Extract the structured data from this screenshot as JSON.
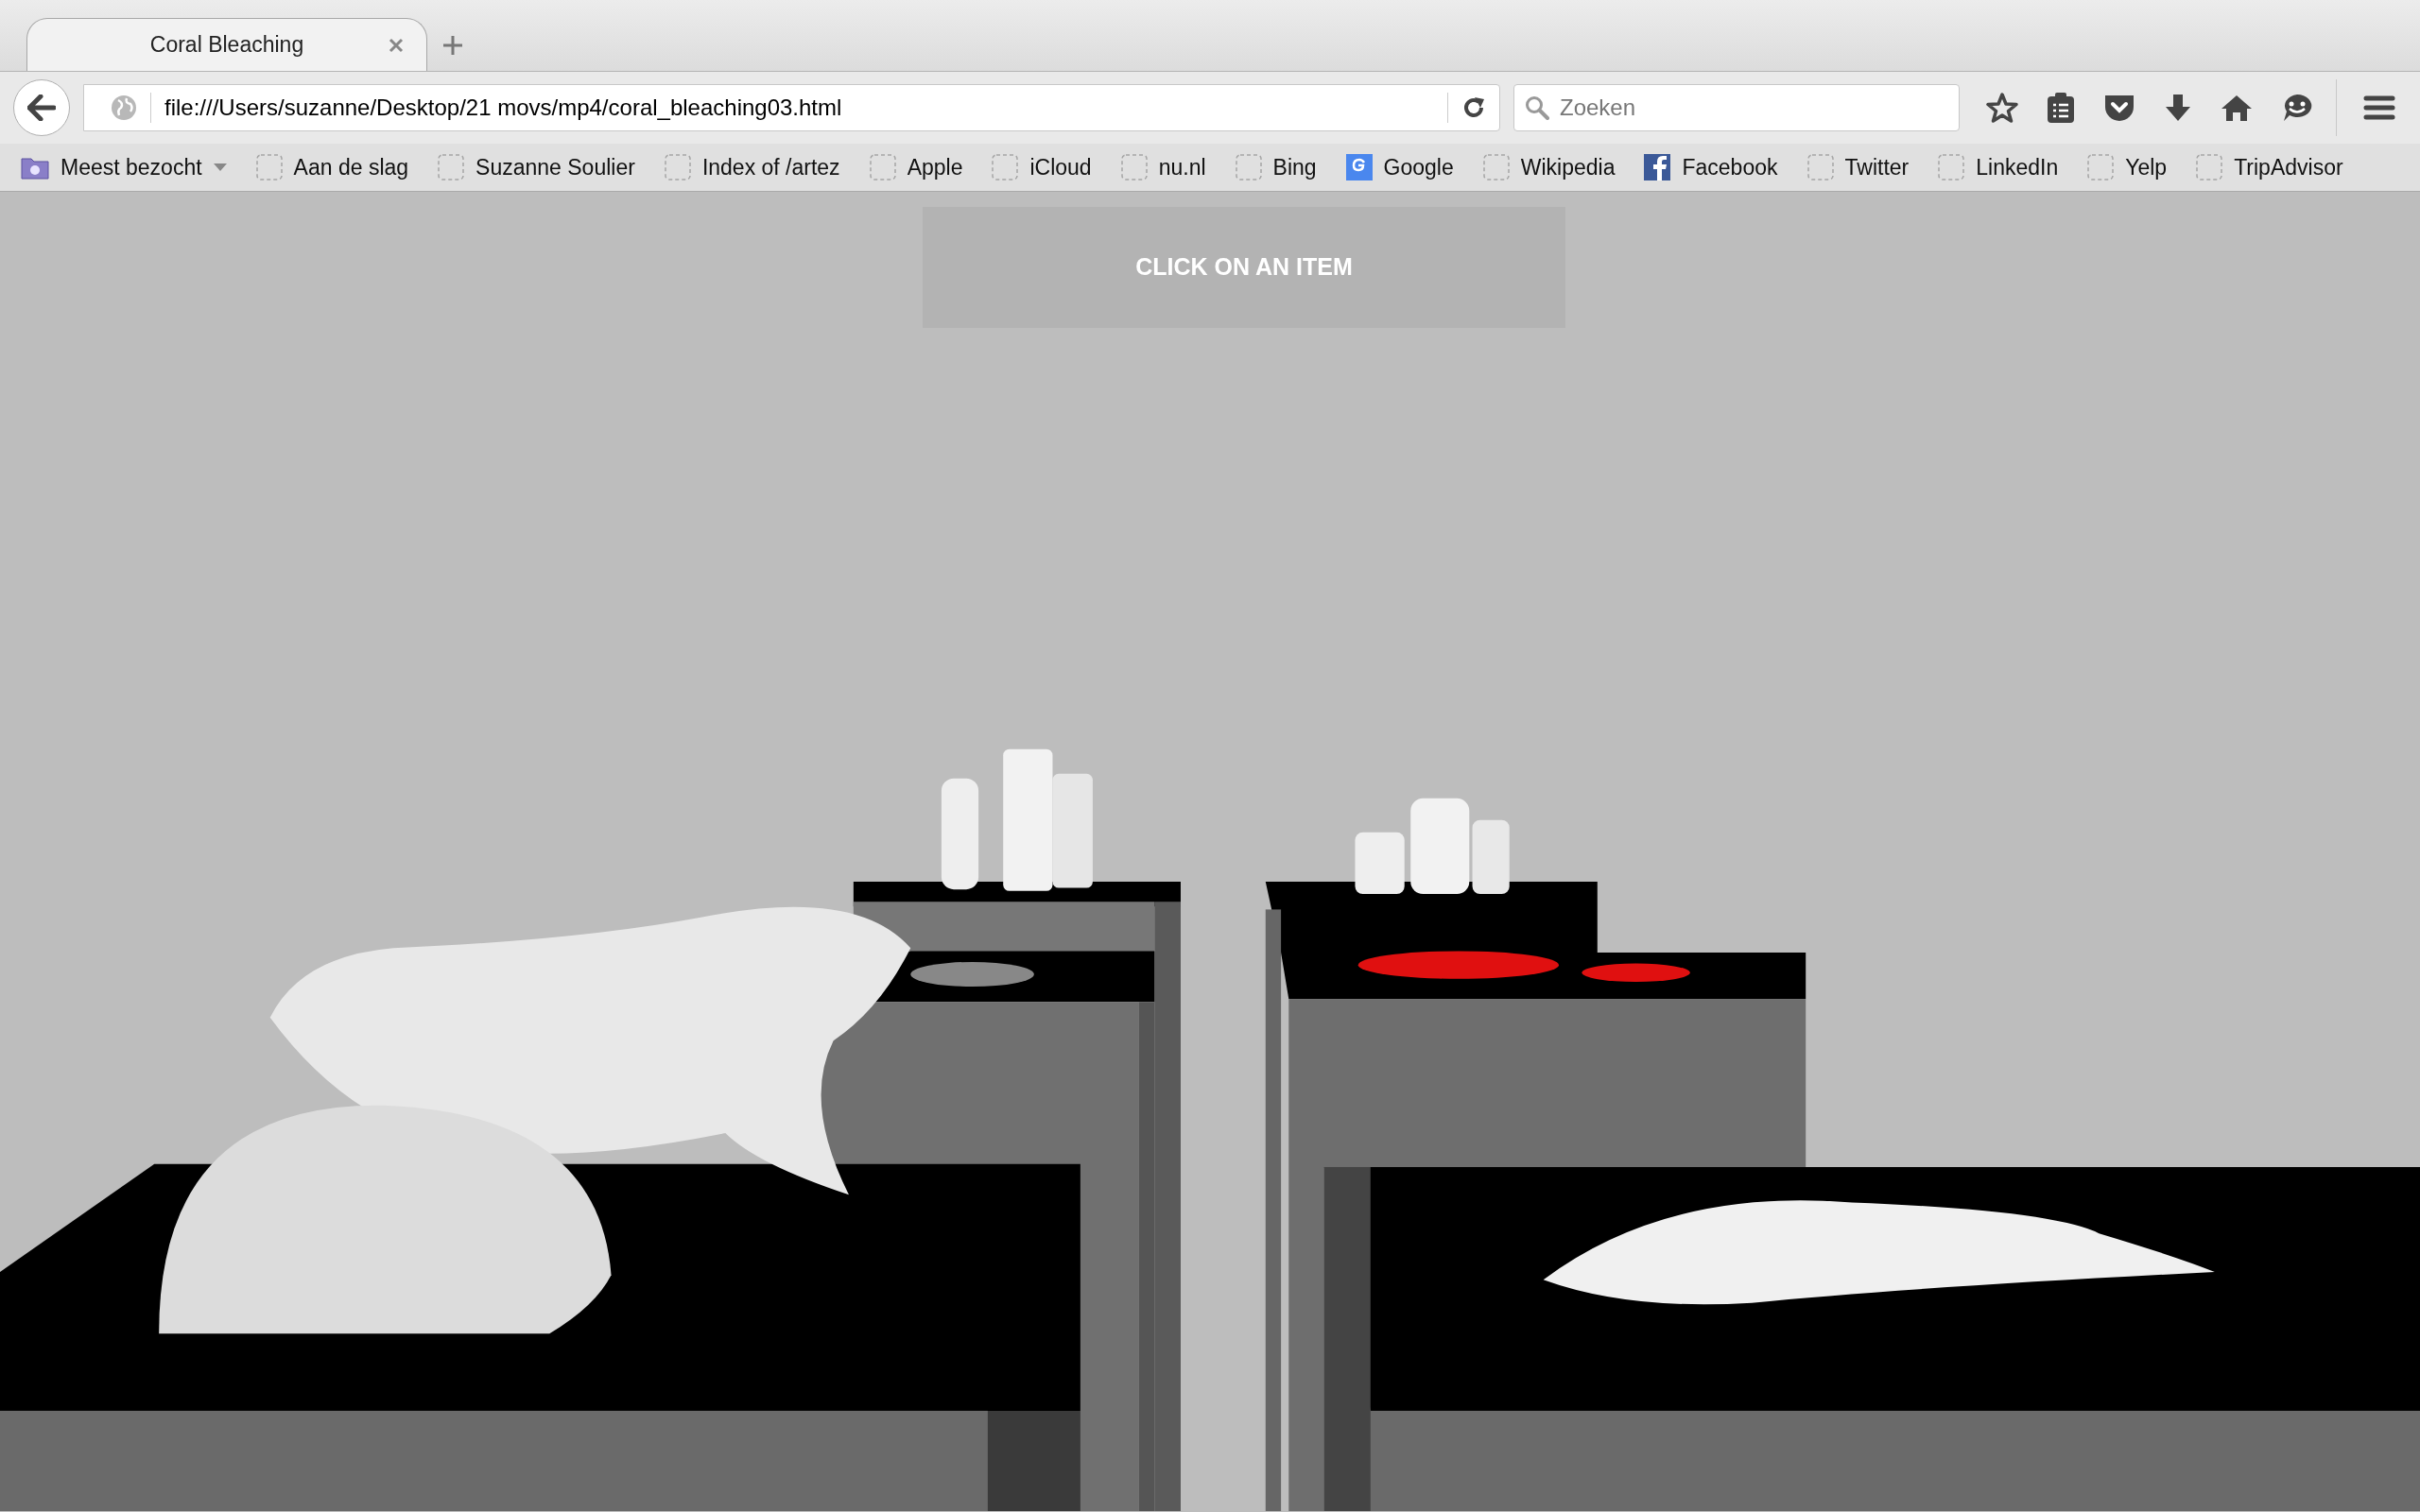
{
  "tabs": [
    {
      "title": "Coral Bleaching",
      "selected": true
    }
  ],
  "address_bar": {
    "url": "file:///Users/suzanne/Desktop/21 movs/mp4/coral_bleaching03.html"
  },
  "search": {
    "placeholder": "Zoeken"
  },
  "bookmarks": [
    {
      "label": "Meest bezocht",
      "kind": "folder"
    },
    {
      "label": "Aan de slag",
      "kind": "blank"
    },
    {
      "label": "Suzanne Soulier",
      "kind": "blank"
    },
    {
      "label": "Index of /artez",
      "kind": "blank"
    },
    {
      "label": "Apple",
      "kind": "blank"
    },
    {
      "label": "iCloud",
      "kind": "blank"
    },
    {
      "label": "nu.nl",
      "kind": "blank"
    },
    {
      "label": "Bing",
      "kind": "blank"
    },
    {
      "label": "Google",
      "kind": "google"
    },
    {
      "label": "Wikipedia",
      "kind": "blank"
    },
    {
      "label": "Facebook",
      "kind": "facebook"
    },
    {
      "label": "Twitter",
      "kind": "blank"
    },
    {
      "label": "LinkedIn",
      "kind": "blank"
    },
    {
      "label": "Yelp",
      "kind": "blank"
    },
    {
      "label": "TripAdvisor",
      "kind": "blank"
    }
  ],
  "page": {
    "banner": "CLICK ON AN ITEM"
  }
}
